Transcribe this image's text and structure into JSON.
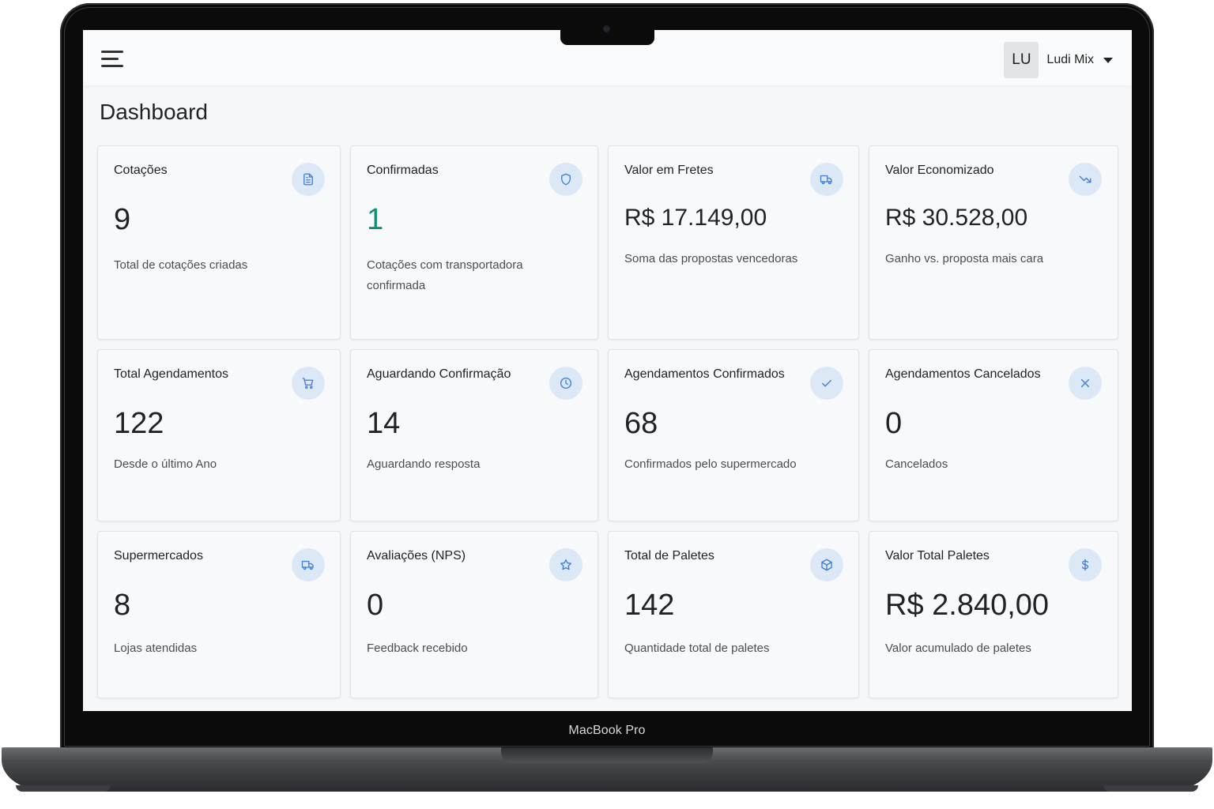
{
  "device": {
    "label": "MacBook Pro"
  },
  "topbar": {
    "user_initials": "LU",
    "user_name": "Ludi Mix"
  },
  "page": {
    "title": "Dashboard"
  },
  "cards": [
    {
      "title": "Cotações",
      "value": "9",
      "description": "Total de cotações criadas",
      "icon": "document-icon"
    },
    {
      "title": "Confirmadas",
      "value": "1",
      "description": "Cotações com transportadora confirmada",
      "icon": "shield-icon",
      "value_color": "#0e8f73"
    },
    {
      "title": "Valor em Fretes",
      "value": "R$ 17.149,00",
      "description": "Soma das propostas vencedoras",
      "icon": "truck-icon"
    },
    {
      "title": "Valor Economizado",
      "value": "R$ 30.528,00",
      "description": "Ganho vs. proposta mais cara",
      "icon": "trending-down-icon"
    },
    {
      "title": "Total Agendamentos",
      "value": "122",
      "description": "Desde o último Ano",
      "icon": "cart-icon"
    },
    {
      "title": "Aguardando Confirmação",
      "value": "14",
      "description": "Aguardando resposta",
      "icon": "clock-icon"
    },
    {
      "title": "Agendamentos Confirmados",
      "value": "68",
      "description": "Confirmados pelo supermercado",
      "icon": "check-icon"
    },
    {
      "title": "Agendamentos Cancelados",
      "value": "0",
      "description": "Cancelados",
      "icon": "close-icon"
    },
    {
      "title": "Supermercados",
      "value": "8",
      "description": "Lojas atendidas",
      "icon": "truck-icon"
    },
    {
      "title": "Avaliações (NPS)",
      "value": "0",
      "description": "Feedback recebido",
      "icon": "star-icon"
    },
    {
      "title": "Total de Paletes",
      "value": "142",
      "description": "Quantidade total de paletes",
      "icon": "box-icon"
    },
    {
      "title": "Valor Total Paletes",
      "value": "R$ 2.840,00",
      "description": "Valor acumulado de paletes",
      "icon": "dollar-icon"
    }
  ],
  "colors": {
    "accent": "#3f7ed3",
    "icon_bg": "#dde8f7",
    "positive": "#0e8f73"
  }
}
